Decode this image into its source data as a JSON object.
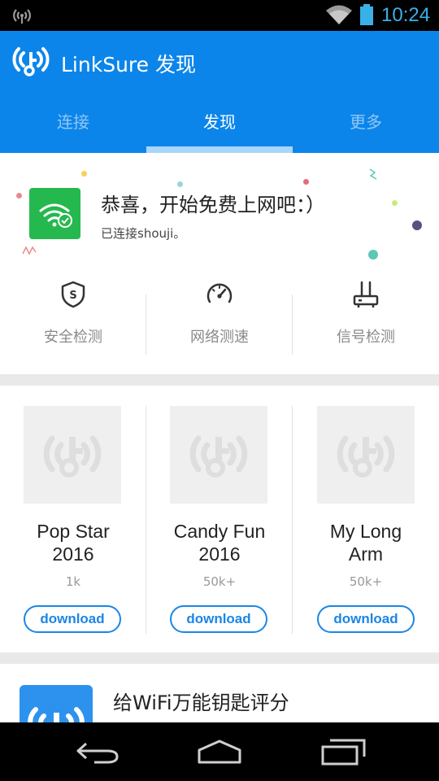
{
  "status_bar": {
    "time": "10:24",
    "icons": [
      "hotspot-icon",
      "wifi-signal-icon",
      "battery-icon"
    ]
  },
  "app_bar": {
    "title": "LinkSure 发现",
    "tabs": [
      {
        "label": "连接",
        "active": false
      },
      {
        "label": "发现",
        "active": true
      },
      {
        "label": "更多",
        "active": false
      }
    ]
  },
  "connected": {
    "title": "恭喜，开始免费上网吧：）",
    "subtitle": "已连接shouji。",
    "tools": [
      {
        "label": "安全检测",
        "icon": "shield-icon"
      },
      {
        "label": "网络测速",
        "icon": "speedometer-icon"
      },
      {
        "label": "信号检测",
        "icon": "router-icon"
      }
    ]
  },
  "apps": [
    {
      "name_lines": [
        "Pop Star",
        "2016"
      ],
      "count": "1k",
      "button": "download"
    },
    {
      "name_lines": [
        "Candy Fun",
        "2016"
      ],
      "count": "50k+",
      "button": "download"
    },
    {
      "name_lines": [
        "My Long",
        "Arm"
      ],
      "count": "50k+",
      "button": "download"
    }
  ],
  "rate": {
    "text": "给WiFi万能钥匙评分"
  },
  "colors": {
    "primary": "#0c85ea",
    "wifi_green": "#25b84e",
    "download_blue": "#1a86e6",
    "status_accent": "#3ab0e8"
  }
}
